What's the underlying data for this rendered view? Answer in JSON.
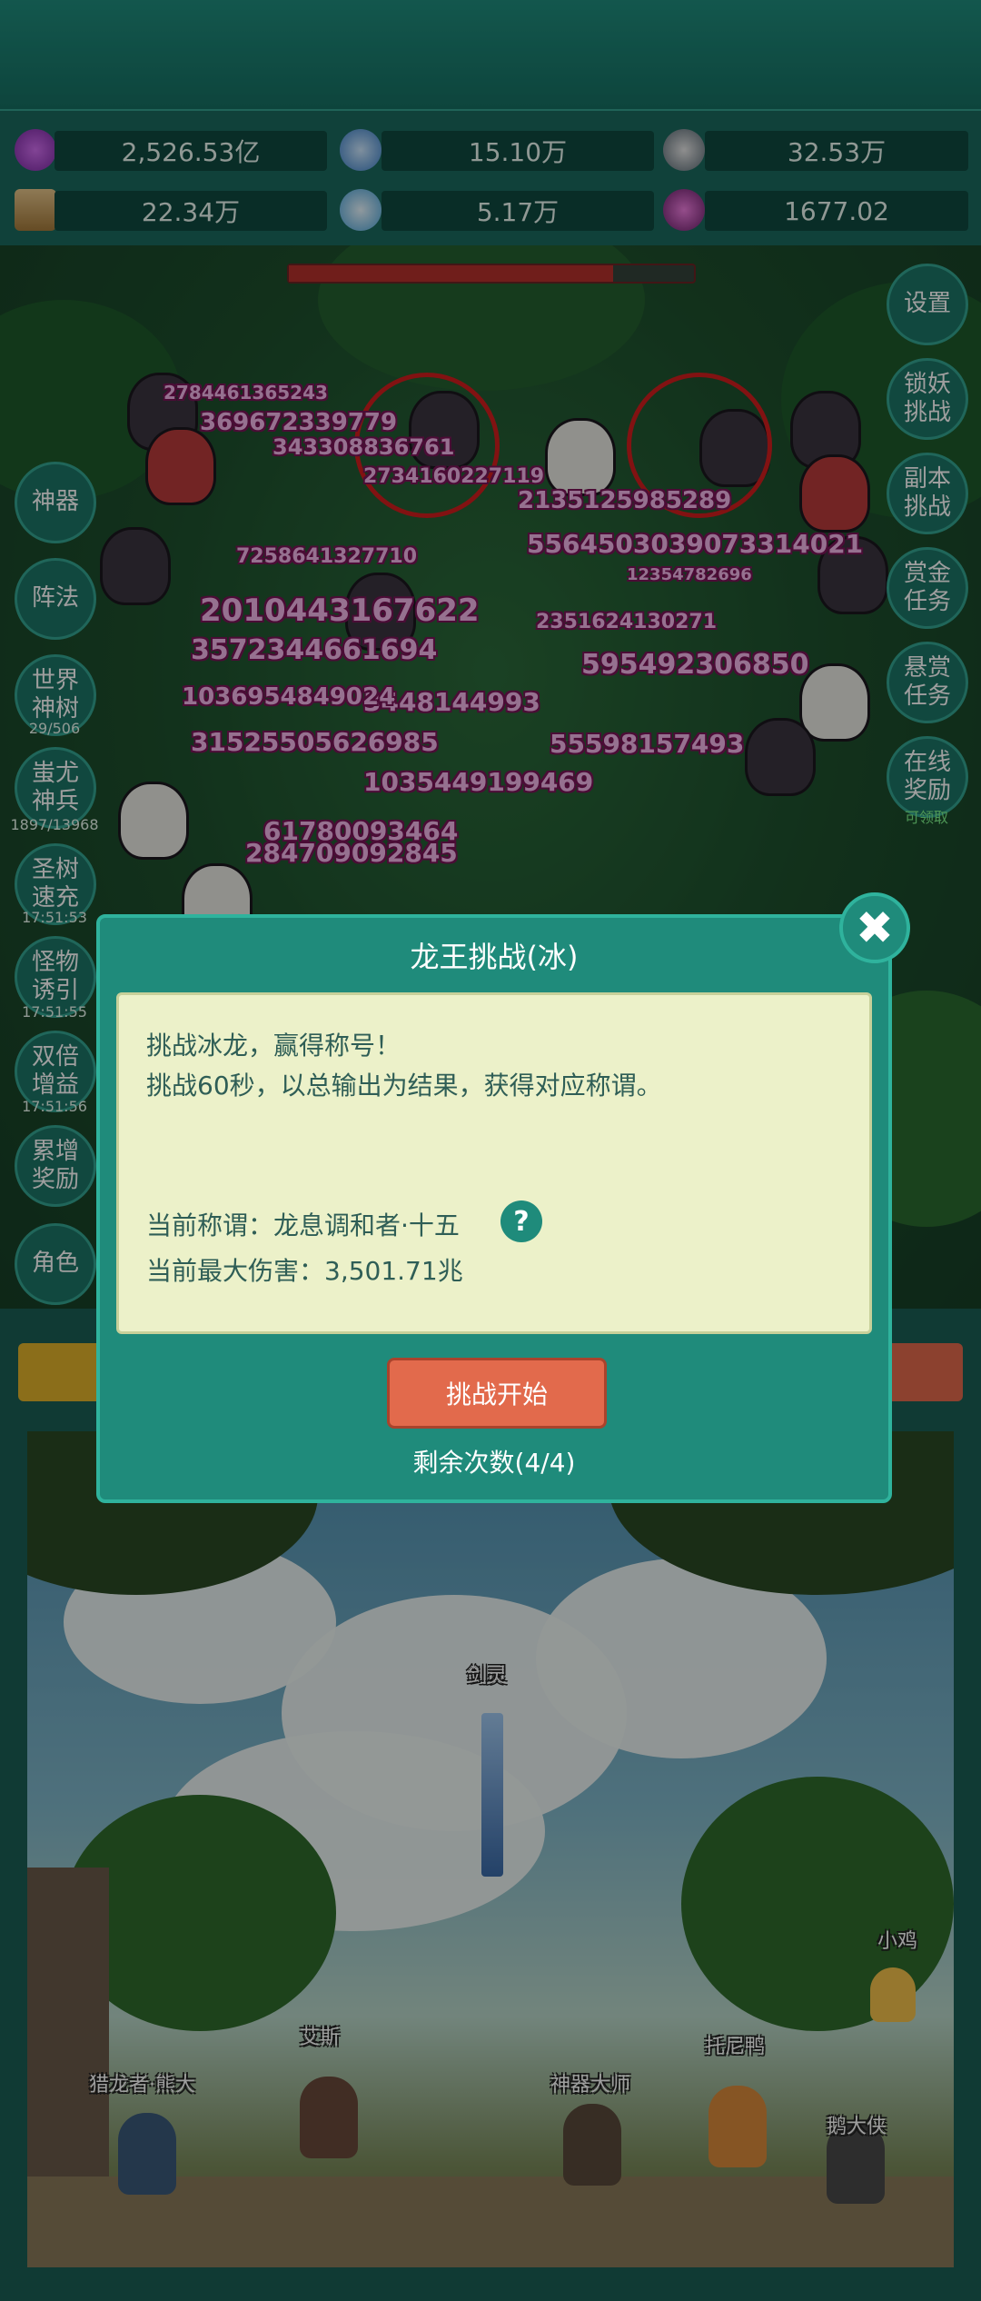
{
  "resources": [
    {
      "icon": "purple-gem-icon",
      "value": "2,526.53亿"
    },
    {
      "icon": "blue-crystal-icon",
      "value": "15.10万"
    },
    {
      "icon": "gray-orb-icon",
      "value": "32.53万"
    },
    {
      "icon": "scroll-icon",
      "value": "22.34万"
    },
    {
      "icon": "ice-crystal-icon",
      "value": "5.17万"
    },
    {
      "icon": "purple-pot-icon",
      "value": "1677.02"
    }
  ],
  "right_buttons": [
    "设置",
    "锁妖\n挑战",
    "副本\n挑战",
    "赏金\n任务",
    "悬赏\n任务",
    "在线\n奖励"
  ],
  "right_online_status": "可领取",
  "left_buttons": [
    {
      "label": "神器",
      "sub": ""
    },
    {
      "label": "阵法",
      "sub": ""
    },
    {
      "label": "世界\n神树",
      "sub": "29/506"
    },
    {
      "label": "蚩尤\n神兵",
      "sub": "1897/13968"
    },
    {
      "label": "圣树\n速充",
      "sub": "17:51:53"
    },
    {
      "label": "怪物\n诱引",
      "sub": "17:51:55"
    },
    {
      "label": "双倍\n增益",
      "sub": "17:51:56"
    },
    {
      "label": "累增\n奖励",
      "sub": ""
    },
    {
      "label": "角色",
      "sub": ""
    }
  ],
  "damage_numbers": [
    "2784461365243",
    "369672339779",
    "343308836761",
    "2734160227119",
    "2135125985289",
    "5564503039073314021",
    "7258641327710",
    "2010443167622",
    "3572344661694",
    "3448144993",
    "1036954849024",
    "31525505626985",
    "55598157493",
    "1035449199469",
    "61780093464",
    "284709092845",
    "595492306850",
    "2351624130271",
    "12354782696"
  ],
  "boss_hp_fraction": 0.8,
  "modal": {
    "title": "龙王挑战(冰)",
    "line1": "挑战冰龙，赢得称号！",
    "line2": "挑战60秒，以总输出为结果，获得对应称谓。",
    "title_label": "当前称谓：龙息调和者·十五",
    "help": "?",
    "max_damage": "当前最大伤害：3,501.71兆",
    "start_button": "挑战开始",
    "remaining": "剩余次数(4/4)",
    "close": "✖"
  },
  "scene_labels": {
    "sword": "剑灵",
    "chicken": "小鸡",
    "ace": "艾斯",
    "tony": "托尼鸭",
    "hunter": "猎龙者·熊大",
    "smith": "神器大师",
    "goose": "鹅大侠"
  }
}
